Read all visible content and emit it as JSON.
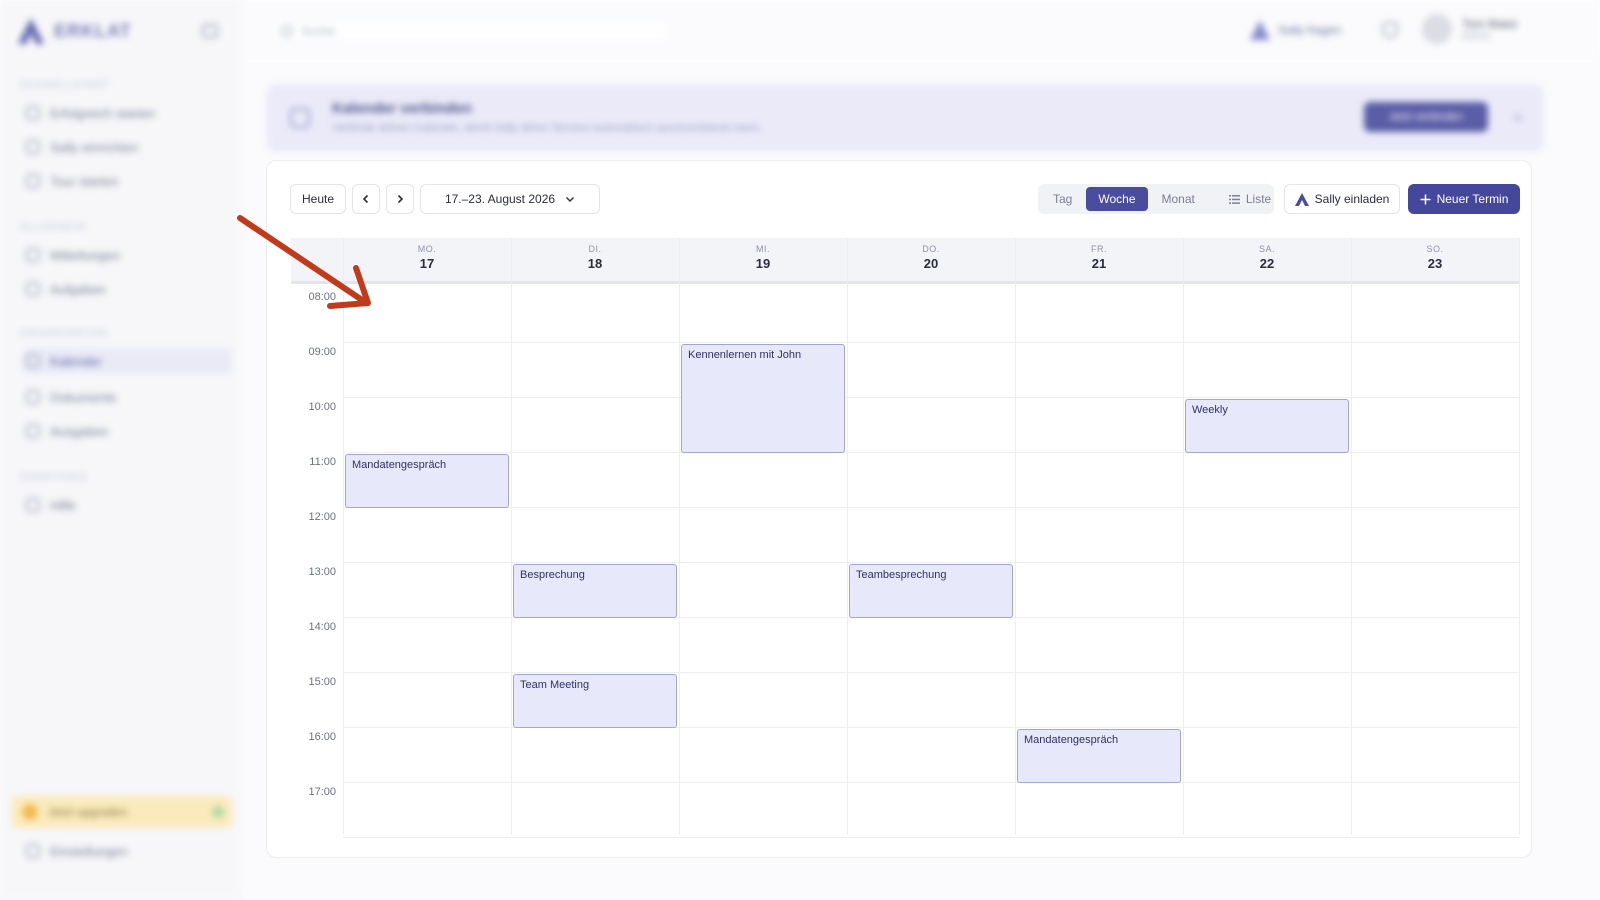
{
  "app": {
    "logo_text": "ERKLAT",
    "search_placeholder": "Suche",
    "ask_label": "Sally fragen",
    "user_name": "Tom Maier",
    "user_role": "Admin"
  },
  "sidebar": {
    "sections": [
      {
        "title": "Schnellstart",
        "items": [
          "Erfolgreich starten",
          "Sally einrichten",
          "Tour starten"
        ]
      },
      {
        "title": "Allgemein",
        "items": [
          "Mitteilungen",
          "Aufgaben"
        ]
      },
      {
        "title": "Organisation",
        "items": [
          "Kalender",
          "Dokumente",
          "Ausgaben"
        ]
      },
      {
        "title": "Sonstiges",
        "items": [
          "Hilfe"
        ]
      }
    ],
    "active_item": "Kalender",
    "promo_label": "Jetzt upgraden",
    "settings_label": "Einstellungen"
  },
  "banner": {
    "title": "Kalender verbinden",
    "description": "Verbinde deinen Kalender, damit Sally deine Termine automatisch synchronisieren kann.",
    "button": "Jetzt verbinden"
  },
  "toolbar": {
    "today": "Heute",
    "prev": "‹",
    "next": "›",
    "range": "17.–23. August 2026",
    "views": [
      "Tag",
      "Woche",
      "Monat",
      "Liste"
    ],
    "active_view": "Woche",
    "invite": "Sally einladen",
    "new_event": "Neuer Termin"
  },
  "calendar": {
    "days": [
      {
        "name": "MO.",
        "date": "17"
      },
      {
        "name": "DI.",
        "date": "18"
      },
      {
        "name": "MI.",
        "date": "19"
      },
      {
        "name": "DO.",
        "date": "20"
      },
      {
        "name": "FR.",
        "date": "21"
      },
      {
        "name": "SA.",
        "date": "22"
      },
      {
        "name": "SO.",
        "date": "23"
      }
    ],
    "times": [
      "08:00",
      "09:00",
      "10:00",
      "11:00",
      "12:00",
      "13:00",
      "14:00",
      "15:00",
      "16:00",
      "17:00"
    ],
    "events": [
      {
        "title": "Kennenlernen mit John",
        "day": 2,
        "start": "09:00",
        "end": "11:00"
      },
      {
        "title": "Weekly",
        "day": 5,
        "start": "10:00",
        "end": "11:00"
      },
      {
        "title": "Mandatengespräch",
        "day": 0,
        "start": "11:00",
        "end": "12:00"
      },
      {
        "title": "Besprechung",
        "day": 1,
        "start": "13:00",
        "end": "14:00"
      },
      {
        "title": "Teambesprechung",
        "day": 3,
        "start": "13:00",
        "end": "14:00"
      },
      {
        "title": "Team Meeting",
        "day": 1,
        "start": "15:00",
        "end": "16:00"
      },
      {
        "title": "Mandatengespräch",
        "day": 4,
        "start": "16:00",
        "end": "17:00"
      }
    ]
  },
  "colors": {
    "accent": "#45479a",
    "event_fill": "#e8e8fb",
    "event_border": "#a2a4d8",
    "annotation_arrow": "#c23a1c"
  }
}
